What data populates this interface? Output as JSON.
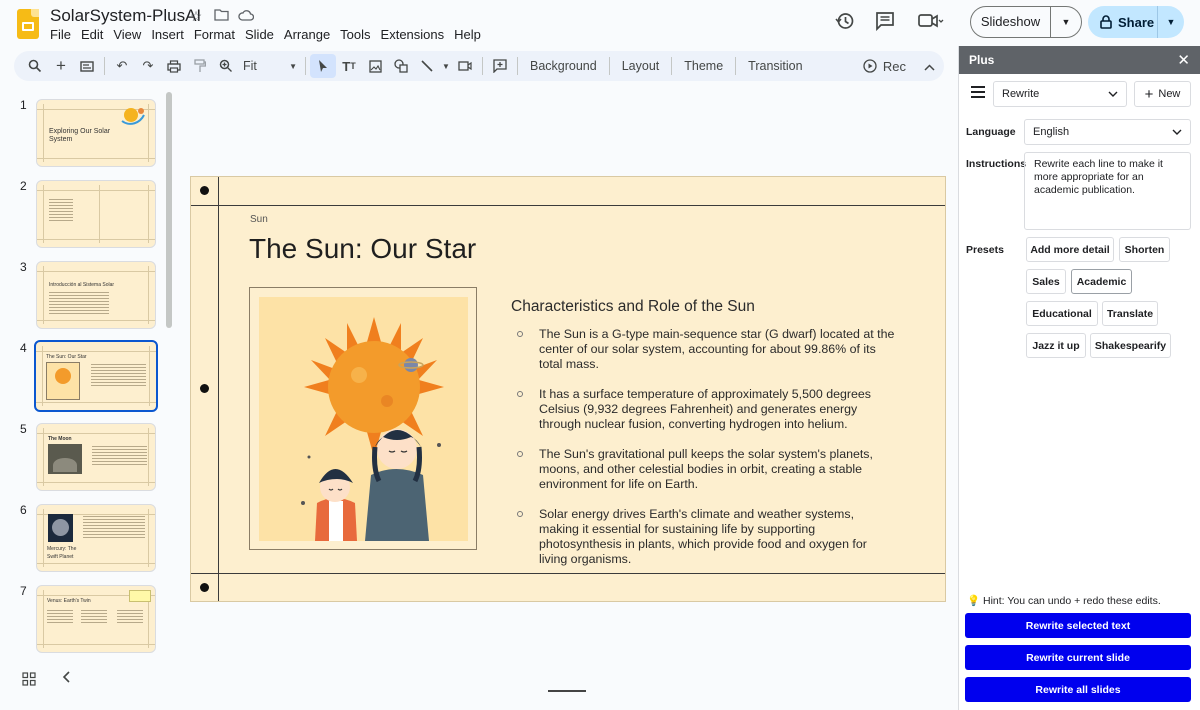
{
  "app": {
    "doc_title": "SolarSystem-PlusAI",
    "menu": [
      "File",
      "Edit",
      "View",
      "Insert",
      "Format",
      "Slide",
      "Arrange",
      "Tools",
      "Extensions",
      "Help"
    ],
    "slideshow_label": "Slideshow",
    "share_label": "Share"
  },
  "toolbar": {
    "zoom": "Fit",
    "background_label": "Background",
    "layout_label": "Layout",
    "theme_label": "Theme",
    "transition_label": "Transition",
    "rec_label": "Rec"
  },
  "filmstrip": {
    "selected_slide": 4,
    "slides": [
      {
        "num": "1",
        "title": "Exploring Our Solar System"
      },
      {
        "num": "2",
        "title": ""
      },
      {
        "num": "3",
        "title": "Introducción al Sistema Solar"
      },
      {
        "num": "4",
        "title": "The Sun: Our Star"
      },
      {
        "num": "5",
        "title": "The Moon"
      },
      {
        "num": "6",
        "title": "Mercury: The Swift Planet"
      },
      {
        "num": "7",
        "title": "Venus: Earth's Twin"
      }
    ]
  },
  "slide": {
    "section": "Sun",
    "title": "The Sun: Our Star",
    "heading": "Characteristics and Role of the Sun",
    "bullets": [
      "The Sun is a G-type main-sequence star (G dwarf) located at the center of our solar system, accounting for about 99.86% of its total mass.",
      "It has a surface temperature of approximately 5,500 degrees Celsius (9,932 degrees Fahrenheit) and generates energy through nuclear fusion, converting hydrogen into helium.",
      "The Sun's gravitational pull keeps the solar system's planets, moons, and other celestial bodies in orbit, creating a stable environment for life on Earth.",
      "Solar energy drives Earth's climate and weather systems, making it essential for sustaining life by supporting photosynthesis in plants, which provide food and oxygen for living organisms."
    ]
  },
  "plus_panel": {
    "title": "Plus",
    "mode": "Rewrite",
    "new_label": "New",
    "language_label": "Language",
    "language": "English",
    "instructions_label": "Instructions",
    "instructions": "Rewrite each line to make it more appropriate for an academic publication.",
    "presets_label": "Presets",
    "presets": [
      "Add more detail",
      "Shorten",
      "Sales",
      "Academic",
      "Educational",
      "Translate",
      "Jazz it up",
      "Shakespearify"
    ],
    "selected_preset": "Academic",
    "hint": "Hint: You can undo + redo these edits.",
    "actions": [
      "Rewrite selected text",
      "Rewrite current slide",
      "Rewrite all slides"
    ]
  },
  "colors": {
    "slide_bg": "#fdefcf",
    "accent": "#0b57d0",
    "action_button": "#0000ee",
    "share_bg": "#c2e7ff"
  }
}
